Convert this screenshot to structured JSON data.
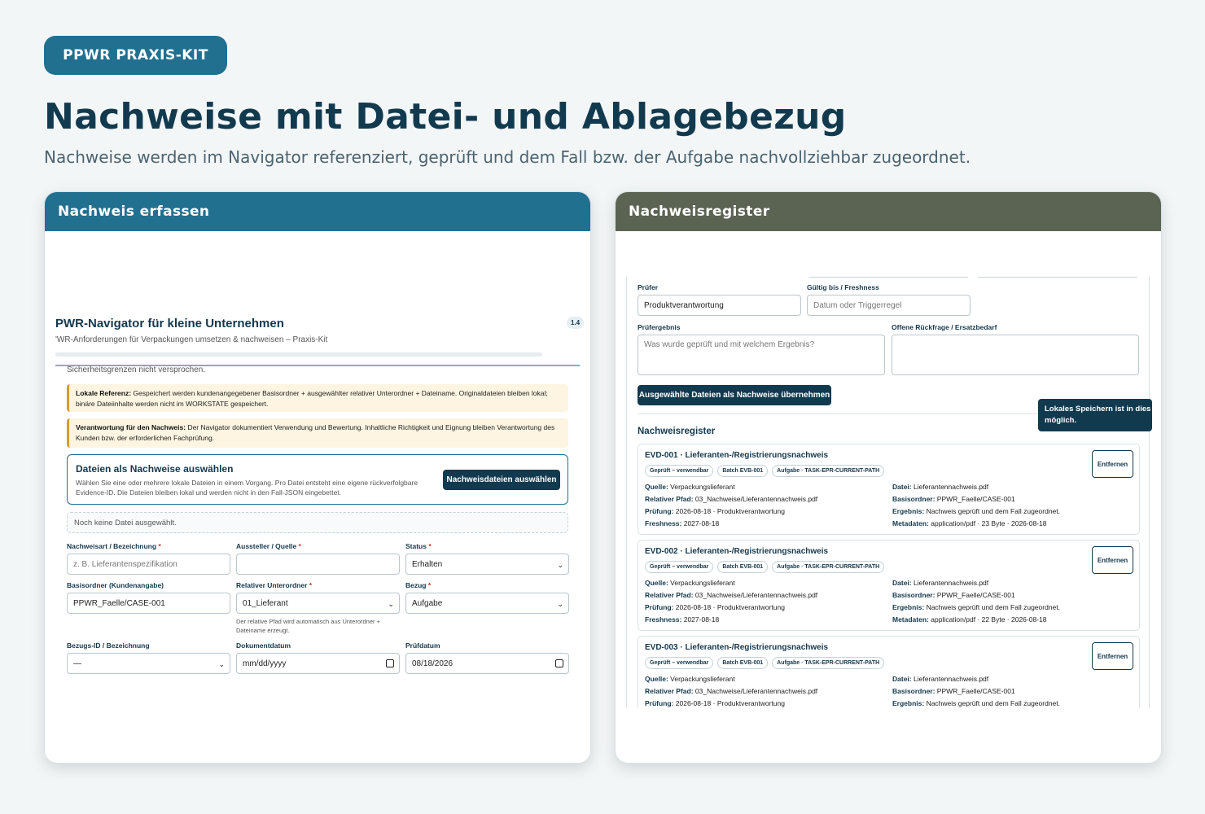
{
  "badge": "PPWR PRAXIS-KIT",
  "title": "Nachweise mit Datei- und Ablagebezug",
  "subtitle": "Nachweise werden im Navigator referenziert, geprüft und dem Fall bzw. der Aufgabe nachvollziehbar zugeordnet.",
  "left": {
    "header": "Nachweis erfassen",
    "app_title": "PWR-Navigator für kleine Unternehmen",
    "app_subtitle": "'WR-Anforderungen für Verpackungen umsetzen & nachweisen – Praxis-Kit",
    "version": "1.4",
    "cut_text": "Sicherheitsgrenzen nicht versprochen.",
    "note1_bold": "Lokale Referenz:",
    "note1_text": " Gespeichert werden kundenangegebener Basisordner + ausgewählter relativer Unterordner + Dateiname. Originaldateien bleiben lokal; binäre Dateiinhalte werden nicht im WORKSTATE gespeichert.",
    "note2_bold": "Verantwortung für den Nachweis:",
    "note2_text": " Der Navigator dokumentiert Verwendung und Bewertung. Inhaltliche Richtigkeit und Eignung bleiben Verantwortung des Kunden bzw. der erforderlichen Fachprüfung.",
    "file_title": "Dateien als Nachweise auswählen",
    "file_desc": "Wählen Sie eine oder mehrere lokale Dateien in einem Vorgang. Pro Datei entsteht eine eigene rückverfolgbare Evidence-ID. Die Dateien bleiben lokal und werden nicht in den Fall-JSON eingebettet.",
    "file_button": "Nachweisdateien auswählen",
    "empty": "Noch keine Datei ausgewählt.",
    "fields": {
      "art_label": "Nachweisart / Bezeichnung",
      "art_placeholder": "z. B. Lieferantenspezifikation",
      "aussteller_label": "Aussteller / Quelle",
      "status_label": "Status",
      "status_value": "Erhalten",
      "basis_label": "Basisordner (Kundenangabe)",
      "basis_value": "PPWR_Faelle/CASE-001",
      "unterordner_label": "Relativer Unterordner",
      "unterordner_value": "01_Lieferant",
      "unterordner_help": "Der relative Pfad wird automatisch aus Unterordner + Dateiname erzeugt.",
      "bezug_label": "Bezug",
      "bezug_value": "Aufgabe",
      "bezugsid_label": "Bezugs-ID / Bezeichnung",
      "bezugsid_value": "—",
      "dokdatum_label": "Dokumentdatum",
      "dokdatum_value": "mm/dd/yyyy",
      "pruefdatum_label": "Prüfdatum",
      "pruefdatum_value": "08/18/2026",
      "required_mark": "*"
    }
  },
  "right": {
    "header": "Nachweisregister",
    "pruefer_label": "Prüfer",
    "pruefer_value": "Produktverantwortung",
    "gueltig_label": "Gültig bis / Freshness",
    "gueltig_placeholder": "Datum oder Triggerregel",
    "ergebnis_label": "Prüfergebnis",
    "ergebnis_placeholder": "Was wurde geprüft und mit welchem Ergebnis?",
    "rueckfrage_label": "Offene Rückfrage / Ersatzbedarf",
    "apply_button": "Ausgewählte Dateien als Nachweise übernehmen",
    "toast_line1": "Lokales Speichern ist in dies",
    "toast_line2": "möglich.",
    "register_title": "Nachweisregister",
    "remove_label": "Entfernen",
    "keys": {
      "quelle": "Quelle:",
      "pfad": "Relativer Pfad:",
      "pruefung": "Prüfung:",
      "freshness": "Freshness:",
      "datei": "Datei:",
      "basis": "Basisordner:",
      "ergebnis": "Ergebnis:",
      "meta": "Metadaten:"
    },
    "entries": [
      {
        "title": "EVD-001 · Lieferanten-/Registrierungsnachweis",
        "tag1": "Geprüft – verwendbar",
        "tag2": "Batch EVB-001",
        "tag3": "Aufgabe · TASK-EPR-CURRENT-PATH",
        "quelle": " Verpackungslieferant",
        "pfad": " 03_Nachweise/Lieferantennachweis.pdf",
        "pruefung": " 2026-08-18 · Produktverantwortung",
        "freshness": " 2027-08-18",
        "datei": " Lieferantennachweis.pdf",
        "basis": " PPWR_Faelle/CASE-001",
        "ergebnis": " Nachweis geprüft und dem Fall zugeordnet.",
        "meta": " application/pdf · 23 Byte · 2026-08-18"
      },
      {
        "title": "EVD-002 · Lieferanten-/Registrierungsnachweis",
        "tag1": "Geprüft – verwendbar",
        "tag2": "Batch EVB-001",
        "tag3": "Aufgabe · TASK-EPR-CURRENT-PATH",
        "quelle": " Verpackungslieferant",
        "pfad": " 03_Nachweise/Lieferantennachweis.pdf",
        "pruefung": " 2026-08-18 · Produktverantwortung",
        "freshness": " 2027-08-18",
        "datei": " Lieferantennachweis.pdf",
        "basis": " PPWR_Faelle/CASE-001",
        "ergebnis": " Nachweis geprüft und dem Fall zugeordnet.",
        "meta": " application/pdf · 22 Byte · 2026-08-18"
      },
      {
        "title": "EVD-003 · Lieferanten-/Registrierungsnachweis",
        "tag1": "Geprüft – verwendbar",
        "tag2": "Batch EVB-001",
        "tag3": "Aufgabe · TASK-EPR-CURRENT-PATH",
        "quelle": " Verpackungslieferant",
        "pfad": " 03_Nachweise/Lieferantennachweis.pdf",
        "pruefung": " 2026-08-18 · Produktverantwortung",
        "datei": " Lieferantennachweis.pdf",
        "basis": " PPWR_Faelle/CASE-001",
        "ergebnis": " Nachweis geprüft und dem Fall zugeordnet."
      }
    ]
  }
}
